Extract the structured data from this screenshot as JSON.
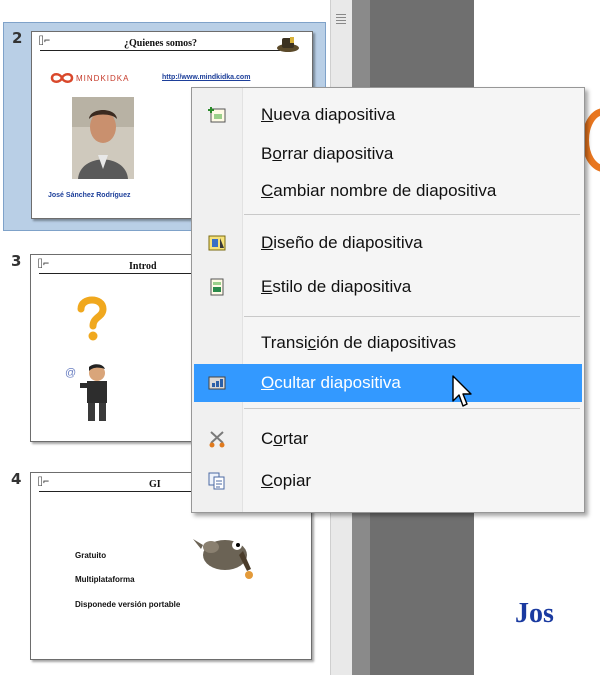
{
  "slides": [
    {
      "number": "2",
      "selected": true,
      "title": "¿Quienes somos?",
      "brand_text": "MINDKIDKA",
      "link_text": "http://www.mindkidka.com",
      "name_caption": "José Sánchez Rodríguez"
    },
    {
      "number": "3",
      "selected": false,
      "title": "Introd"
    },
    {
      "number": "4",
      "selected": false,
      "title": "GI",
      "bullets": [
        "Gratuito",
        "Multiplataforma",
        "Disponede versión portable"
      ]
    }
  ],
  "context_menu": {
    "items": [
      {
        "label": "Nueva diapositiva",
        "icon": "new-slide-icon",
        "hotkey": "N"
      },
      {
        "label": "Borrar diapositiva",
        "icon": "",
        "hotkey": "o"
      },
      {
        "label": "Cambiar nombre de diapositiva",
        "icon": "",
        "hotkey": "C"
      },
      {
        "label": "Diseño de diapositiva",
        "icon": "slide-layout-icon",
        "hotkey": "D"
      },
      {
        "label": "Estilo de diapositiva",
        "icon": "slide-style-icon",
        "hotkey": "E"
      },
      {
        "label": "Transición de diapositivas",
        "icon": "",
        "hotkey": "c"
      },
      {
        "label": "Ocultar diapositiva",
        "icon": "hide-slide-icon",
        "hotkey": "O",
        "highlighted": true
      },
      {
        "label": "Cortar",
        "icon": "scissors-icon",
        "hotkey": "o"
      },
      {
        "label": "Copiar",
        "icon": "copy-icon",
        "hotkey": "C"
      }
    ]
  },
  "editor": {
    "visible_text": "Jos"
  },
  "colors": {
    "selection_bg": "#b9cfe6",
    "menu_highlight": "#3399ff",
    "editor_title": "#1a3aa0",
    "accent_orange": "#e8761f"
  }
}
